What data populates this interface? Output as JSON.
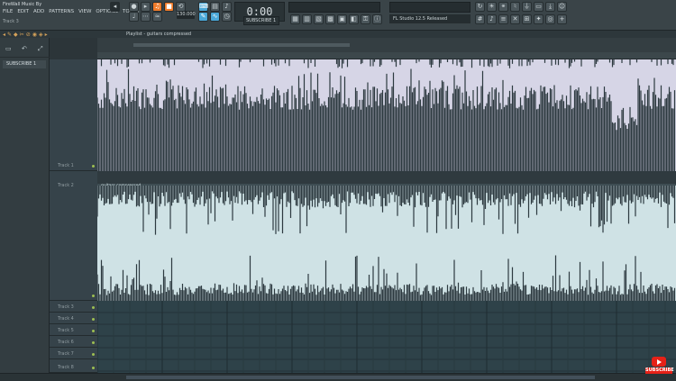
{
  "app": {
    "title": "FireWall Music By",
    "menus": [
      "FILE",
      "EDIT",
      "ADD",
      "PATTERNS",
      "VIEW",
      "OPTIONS",
      "TOOLS",
      "?"
    ],
    "hint": "Track 3"
  },
  "transport": {
    "tempo": "130.000",
    "time": "0:00",
    "pattern": "SUBSCRIBE 1",
    "hint_bar": "FL Studio 12.5 Released"
  },
  "browser": {
    "item": "SUBSCRIBE 1"
  },
  "playlist": {
    "title": "Playlist - guitars compressed",
    "clip2_label": "guitars compressed"
  },
  "tracks": [
    {
      "name": "Track 1"
    },
    {
      "name": "Track 2"
    },
    {
      "name": "Track 3"
    },
    {
      "name": "Track 4"
    },
    {
      "name": "Track 5"
    },
    {
      "name": "Track 6"
    },
    {
      "name": "Track 7"
    },
    {
      "name": "Track 8"
    }
  ],
  "badge": {
    "text": "SUBSCRIBE"
  },
  "colors": {
    "accent_orange": "#f07b2a",
    "accent_blue": "#4aa8d8",
    "clip1_bg": "#d6d5e6",
    "clip2_bg": "#cfe2e5",
    "waveform": "#2d3a40",
    "youtube_red": "#e62117"
  }
}
